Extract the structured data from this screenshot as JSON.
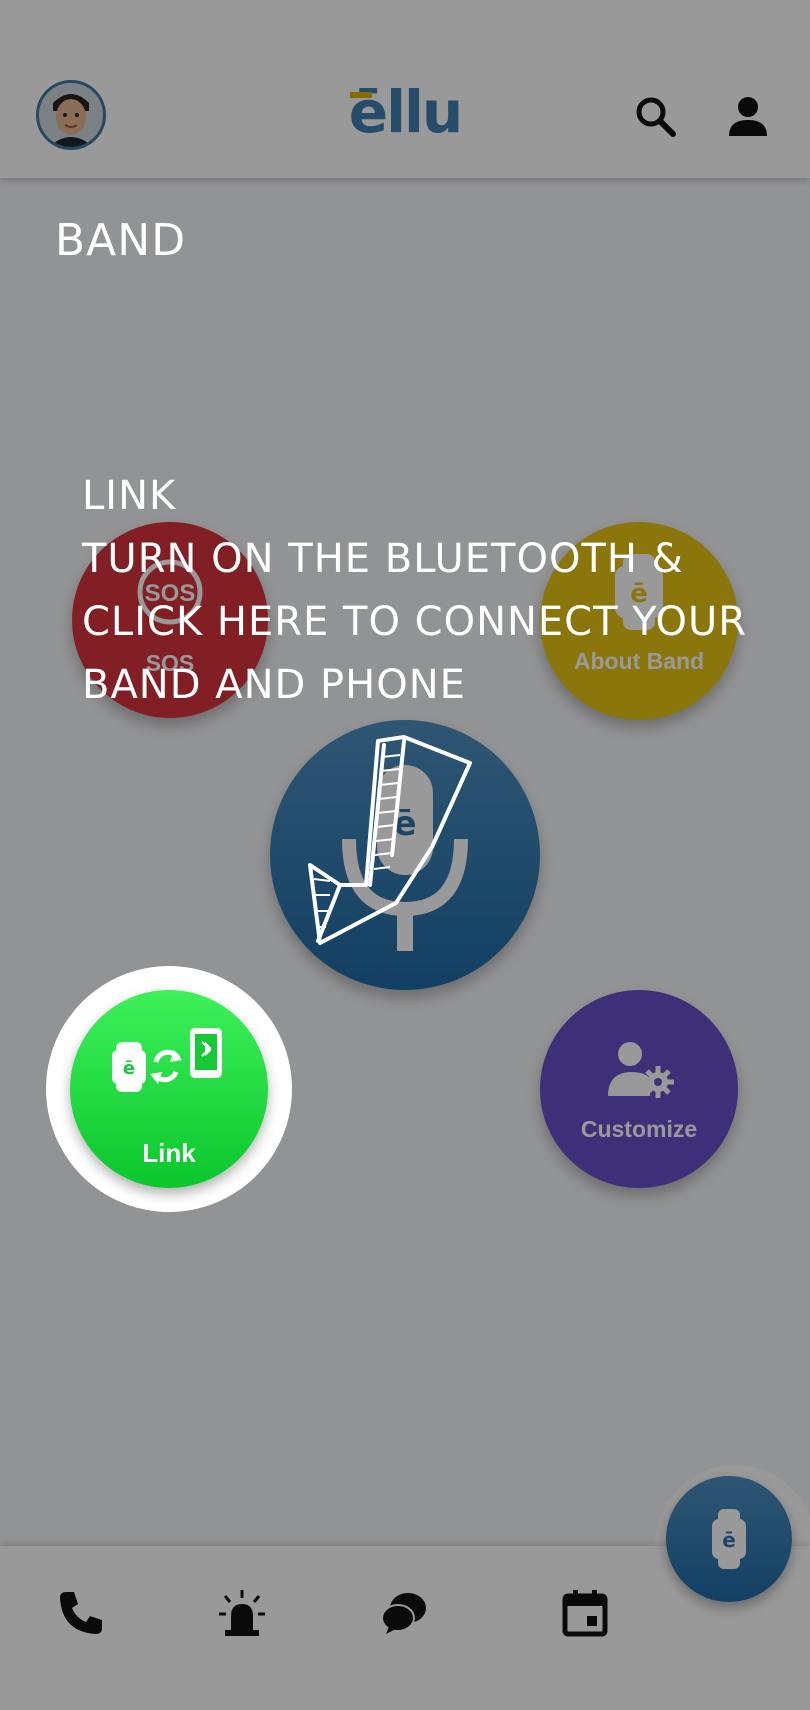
{
  "header": {
    "app_logo": "ēllu",
    "avatar_icon": "user-avatar",
    "search_icon": "search-icon",
    "profile_icon": "person-icon"
  },
  "page": {
    "title": "BAND"
  },
  "actions": {
    "sos": {
      "title": "SOS",
      "label": "SOS",
      "color": "#d9343c"
    },
    "about": {
      "glyph": "ē",
      "label": "About Band",
      "color": "#e8c515"
    },
    "mic": {
      "glyph": "ē",
      "icon": "microphone-icon"
    },
    "link": {
      "label": "Link",
      "glyph": "ē",
      "color": "#17d636"
    },
    "customize": {
      "label": "Customize",
      "color": "#6750c8"
    }
  },
  "onboarding": {
    "lines": [
      "LINK",
      "TURN ON THE BLUETOOTH &",
      "CLICK HERE TO CONNECT YOUR",
      "BAND AND PHONE"
    ]
  },
  "bottom_nav": {
    "items": [
      "phone-icon",
      "alarm-siren-icon",
      "chat-icon",
      "calendar-icon"
    ],
    "fab_glyph": "ē"
  },
  "colors": {
    "brand": "#3f7fae",
    "accent": "#e0b400",
    "overlay": "rgba(0,0,0,0.4)"
  }
}
